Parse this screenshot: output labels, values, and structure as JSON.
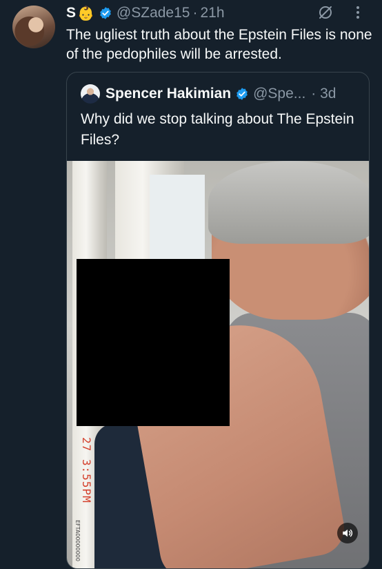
{
  "tweet": {
    "author_name": "S",
    "author_emoji": "👶",
    "handle": "@SZade15",
    "separator": "·",
    "time": "21h",
    "text": "The ugliest truth about the Epstein Files is none of the pedophiles will be arrested."
  },
  "quoted": {
    "author_name": "Spencer Hakimian",
    "handle": "@Spe...",
    "separator": "·",
    "time": "3d",
    "text": "Why did we stop talking about The Epstein Files?",
    "media": {
      "timestamp_stamp": "27  3:55PM",
      "doc_id": "EFTA00000000"
    }
  },
  "icons": {
    "verified": "verified-badge-icon",
    "grok": "grok-icon",
    "more": "more-options-icon",
    "sound": "volume-icon"
  },
  "colors": {
    "background": "#15202b",
    "text": "#f7f9f9",
    "secondary": "#8b98a5",
    "verified_blue": "#1d9bf0",
    "border": "#38444d"
  }
}
